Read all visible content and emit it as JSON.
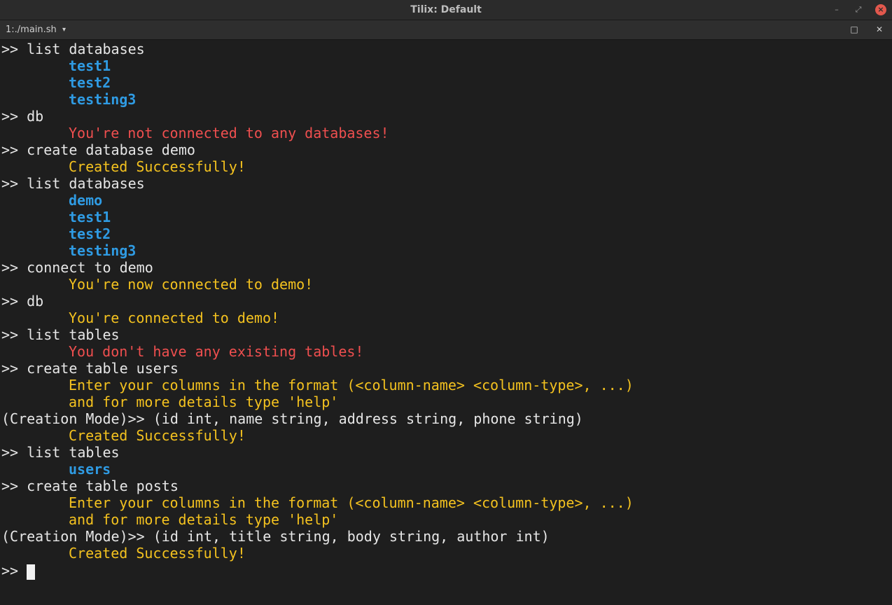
{
  "window": {
    "title": "Tilix: Default",
    "minimize_glyph": "–",
    "maximize_glyph": "⤢",
    "close_glyph": "×"
  },
  "tab": {
    "title": "1:./main.sh",
    "dropdown_glyph": "▾",
    "maximize_glyph": "□",
    "close_glyph": "✕"
  },
  "colors": {
    "background": "#1e1e1e",
    "blue": "#2f9be3",
    "red": "#ef4f4f",
    "yellow": "#f4c21f",
    "text": "#e6e6e6"
  },
  "terminal": {
    "lines": [
      {
        "prompt": ">> ",
        "text": "list databases"
      },
      {
        "indent": true,
        "color": "blue",
        "text": "test1"
      },
      {
        "indent": true,
        "color": "blue",
        "text": "test2"
      },
      {
        "indent": true,
        "color": "blue",
        "text": "testing3"
      },
      {
        "prompt": ">> ",
        "text": "db"
      },
      {
        "indent": true,
        "color": "red",
        "text": "You're not connected to any databases!"
      },
      {
        "prompt": ">> ",
        "text": "create database demo"
      },
      {
        "indent": true,
        "color": "yellow",
        "text": "Created Successfully!"
      },
      {
        "prompt": ">> ",
        "text": "list databases"
      },
      {
        "indent": true,
        "color": "blue",
        "text": "demo"
      },
      {
        "indent": true,
        "color": "blue",
        "text": "test1"
      },
      {
        "indent": true,
        "color": "blue",
        "text": "test2"
      },
      {
        "indent": true,
        "color": "blue",
        "text": "testing3"
      },
      {
        "prompt": ">> ",
        "text": "connect to demo"
      },
      {
        "indent": true,
        "color": "yellow",
        "text": "You're now connected to demo!"
      },
      {
        "prompt": ">> ",
        "text": "db"
      },
      {
        "indent": true,
        "color": "yellow",
        "text": "You're connected to demo!"
      },
      {
        "prompt": ">> ",
        "text": "list tables"
      },
      {
        "indent": true,
        "color": "red",
        "text": "You don't have any existing tables!"
      },
      {
        "prompt": ">> ",
        "text": "create table users"
      },
      {
        "indent": true,
        "color": "yellow",
        "text": "Enter your columns in the format (<column-name> <column-type>, ...)"
      },
      {
        "indent": true,
        "color": "yellow",
        "text": "and for more details type 'help'"
      },
      {
        "prompt": "(Creation Mode)>> ",
        "text": "(id int, name string, address string, phone string)"
      },
      {
        "indent": true,
        "color": "yellow",
        "text": "Created Successfully!"
      },
      {
        "prompt": ">> ",
        "text": "list tables"
      },
      {
        "indent": true,
        "color": "blue",
        "text": "users"
      },
      {
        "prompt": ">> ",
        "text": "create table posts"
      },
      {
        "indent": true,
        "color": "yellow",
        "text": "Enter your columns in the format (<column-name> <column-type>, ...)"
      },
      {
        "indent": true,
        "color": "yellow",
        "text": "and for more details type 'help'"
      },
      {
        "prompt": "(Creation Mode)>> ",
        "text": "(id int, title string, body string, author int)"
      },
      {
        "indent": true,
        "color": "yellow",
        "text": "Created Successfully!"
      }
    ],
    "current_prompt": ">> "
  }
}
